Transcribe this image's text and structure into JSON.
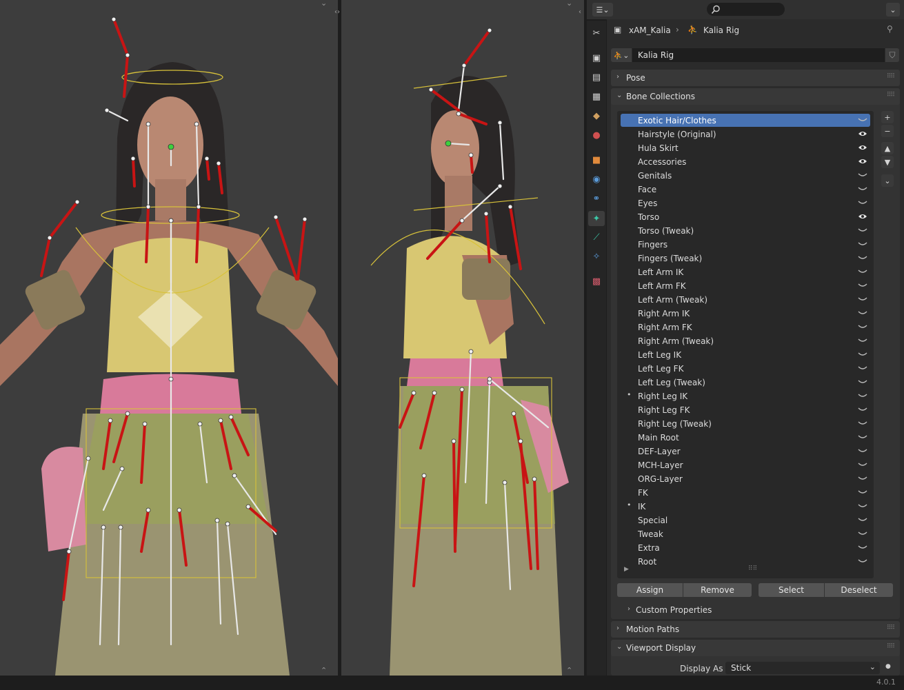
{
  "header": {
    "search_placeholder": ""
  },
  "breadcrumb": {
    "object": "xAM_Kalia",
    "data": "Kalia Rig"
  },
  "armature_name": "Kalia Rig",
  "panels": {
    "pose": "Pose",
    "bone_collections": "Bone Collections",
    "custom_properties": "Custom Properties",
    "motion_paths": "Motion Paths",
    "viewport_display": "Viewport Display"
  },
  "collections": [
    {
      "name": "Exotic Hair/Clothes",
      "selected": true,
      "visible": false,
      "dot": false
    },
    {
      "name": "Hairstyle (Original)",
      "selected": false,
      "visible": true,
      "dot": false
    },
    {
      "name": "Hula Skirt",
      "selected": false,
      "visible": true,
      "dot": false
    },
    {
      "name": "Accessories",
      "selected": false,
      "visible": true,
      "dot": false
    },
    {
      "name": "Genitals",
      "selected": false,
      "visible": false,
      "dot": false
    },
    {
      "name": "Face",
      "selected": false,
      "visible": false,
      "dot": false
    },
    {
      "name": "Eyes",
      "selected": false,
      "visible": false,
      "dot": false
    },
    {
      "name": "Torso",
      "selected": false,
      "visible": true,
      "dot": false
    },
    {
      "name": "Torso (Tweak)",
      "selected": false,
      "visible": false,
      "dot": false
    },
    {
      "name": "Fingers",
      "selected": false,
      "visible": false,
      "dot": false
    },
    {
      "name": "Fingers (Tweak)",
      "selected": false,
      "visible": false,
      "dot": false
    },
    {
      "name": "Left Arm IK",
      "selected": false,
      "visible": false,
      "dot": false
    },
    {
      "name": "Left Arm FK",
      "selected": false,
      "visible": false,
      "dot": false
    },
    {
      "name": "Left Arm (Tweak)",
      "selected": false,
      "visible": false,
      "dot": false
    },
    {
      "name": "Right Arm IK",
      "selected": false,
      "visible": false,
      "dot": false
    },
    {
      "name": "Right Arm FK",
      "selected": false,
      "visible": false,
      "dot": false
    },
    {
      "name": "Right Arm (Tweak)",
      "selected": false,
      "visible": false,
      "dot": false
    },
    {
      "name": "Left Leg IK",
      "selected": false,
      "visible": false,
      "dot": false
    },
    {
      "name": "Left Leg FK",
      "selected": false,
      "visible": false,
      "dot": false
    },
    {
      "name": "Left Leg (Tweak)",
      "selected": false,
      "visible": false,
      "dot": false
    },
    {
      "name": "Right Leg IK",
      "selected": false,
      "visible": false,
      "dot": true
    },
    {
      "name": "Right Leg FK",
      "selected": false,
      "visible": false,
      "dot": false
    },
    {
      "name": "Right Leg (Tweak)",
      "selected": false,
      "visible": false,
      "dot": false
    },
    {
      "name": "Main Root",
      "selected": false,
      "visible": false,
      "dot": false
    },
    {
      "name": "DEF-Layer",
      "selected": false,
      "visible": false,
      "dot": false
    },
    {
      "name": "MCH-Layer",
      "selected": false,
      "visible": false,
      "dot": false
    },
    {
      "name": "ORG-Layer",
      "selected": false,
      "visible": false,
      "dot": false
    },
    {
      "name": "FK",
      "selected": false,
      "visible": false,
      "dot": false
    },
    {
      "name": "IK",
      "selected": false,
      "visible": false,
      "dot": true
    },
    {
      "name": "Special",
      "selected": false,
      "visible": false,
      "dot": false
    },
    {
      "name": "Tweak",
      "selected": false,
      "visible": false,
      "dot": false
    },
    {
      "name": "Extra",
      "selected": false,
      "visible": false,
      "dot": false
    },
    {
      "name": "Root",
      "selected": false,
      "visible": false,
      "dot": false
    }
  ],
  "buttons": {
    "assign": "Assign",
    "remove": "Remove",
    "select": "Select",
    "deselect": "Deselect"
  },
  "display_as": {
    "label": "Display As",
    "value": "Stick"
  },
  "version": "4.0.1",
  "colors": {
    "accent": "#4772b3",
    "bone_red": "#c81414",
    "bone_green": "#3ecf3e",
    "bone_stick": "#e8e8e8",
    "custom_shape": "#d8c23a"
  }
}
